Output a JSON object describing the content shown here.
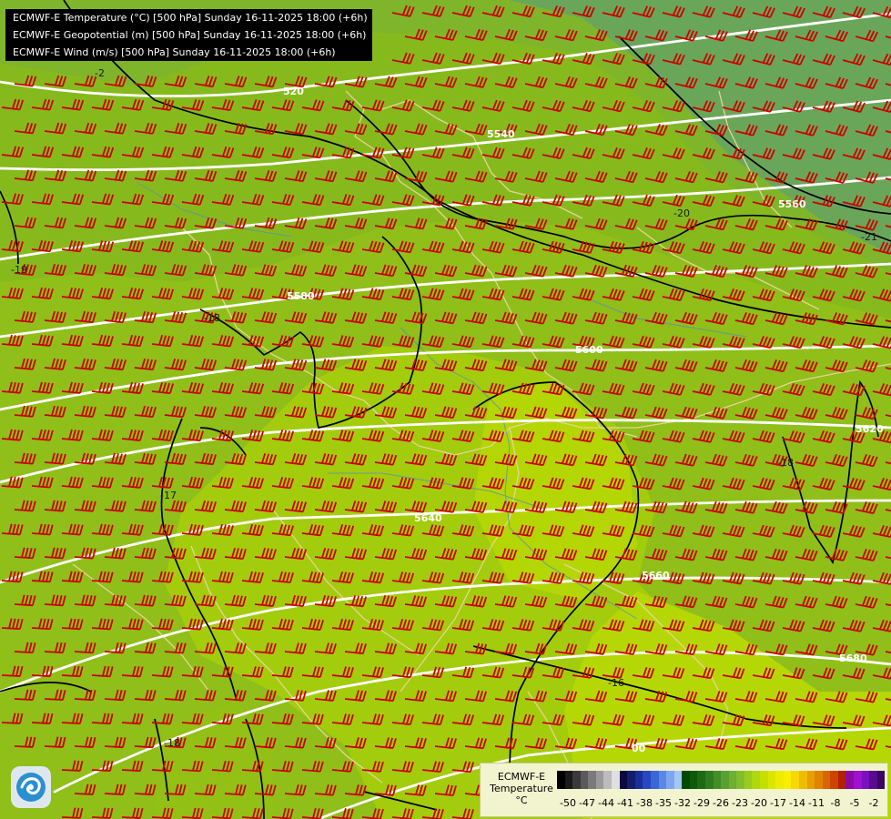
{
  "header": {
    "lines": [
      "ECMWF-E Temperature (°C) [500 hPa] Sunday 16-11-2025 18:00 (+6h)",
      "ECMWF-E Geopotential (m) [500 hPa] Sunday 16-11-2025 18:00 (+6h)",
      "ECMWF-E Wind (m/s) [500 hPa] Sunday 16-11-2025 18:00 (+6h)"
    ]
  },
  "map": {
    "colors": {
      "cold": "#5f9f6e",
      "cool": "#7fb51e",
      "mid": "#93c415",
      "warm": "#a9d108",
      "warmest": "#bbd900",
      "isohypse": "#ffffff",
      "isotherm": "#000000",
      "wind_barb": "#cc0000",
      "borders": "#e6d496",
      "rivers": "#5c8fb8"
    },
    "isohypse_labels": [
      "520",
      "5540",
      "5560",
      "5580",
      "5600",
      "5620",
      "5640",
      "5660",
      "5680",
      "00"
    ],
    "isotherm_labels": [
      "-20",
      "-21",
      "-19",
      "-18",
      "-17",
      "-18",
      "-16",
      "-18",
      "-2"
    ]
  },
  "legend": {
    "title_line1": "ECMWF-E",
    "title_line2": "Temperature",
    "unit": "°C",
    "ticks": [
      "-50",
      "-47",
      "-44",
      "-41",
      "-38",
      "-35",
      "-32",
      "-29",
      "-26",
      "-23",
      "-20",
      "-17",
      "-14",
      "-11",
      "-8",
      "-5",
      "-2"
    ],
    "colors": [
      "#000000",
      "#1a1a1a",
      "#3a3a3a",
      "#5a5a5a",
      "#7a7a7a",
      "#9a9a9a",
      "#bcbcbc",
      "#e0e0e0",
      "#0a0a40",
      "#121d6e",
      "#1a2f9a",
      "#2748c0",
      "#3a66d8",
      "#5a86e6",
      "#7ea6f0",
      "#a4c6f6",
      "#004a00",
      "#0e5a0a",
      "#1e6a14",
      "#307c20",
      "#448e2a",
      "#58a030",
      "#6cb034",
      "#82be2c",
      "#98cc1e",
      "#aed810",
      "#c4e000",
      "#dae600",
      "#ecec00",
      "#f8f000",
      "#f8d800",
      "#f0bc00",
      "#e8a000",
      "#e08400",
      "#d86600",
      "#cc4400",
      "#b42000",
      "#8c0aa0",
      "#a010d0",
      "#7a10c0",
      "#5a0a90",
      "#3a0660"
    ]
  }
}
